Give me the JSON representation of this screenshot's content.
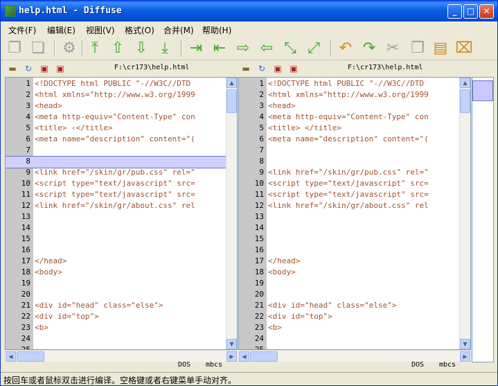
{
  "window": {
    "title": "help.html - Diffuse"
  },
  "menu": [
    "文件(F)",
    "编辑(E)",
    "视图(V)",
    "格式(O)",
    "合并(M)",
    "帮助(H)"
  ],
  "toolbar": {
    "icons": [
      "copy-icon",
      "paste-icon",
      "gear-icon",
      "first-difference-icon",
      "previous-difference-icon",
      "next-difference-icon",
      "last-difference-icon",
      "merge-right-icon",
      "merge-left-icon",
      "copy-right-icon",
      "copy-left-icon",
      "merge-both-right-icon",
      "merge-both-left-icon",
      "undo-icon",
      "redo-icon",
      "cut-icon",
      "copy2-icon",
      "paste2-icon",
      "clear-edits-icon"
    ]
  },
  "left_pane": {
    "path": "F:\\cr173\\help.html",
    "encoding": "DOS",
    "codec": "mbcs",
    "lines": [
      {
        "n": "1",
        "t": "<!DOCTYPE html PUBLIC \"-//W3C//DTD"
      },
      {
        "n": "2",
        "t": "<html xmlns=\"http://www.w3.org/1999"
      },
      {
        "n": "3",
        "t": "<head>"
      },
      {
        "n": "4",
        "t": "<meta http-equiv=\"Content-Type\" con"
      },
      {
        "n": "5",
        "t": "<title>                   ‹</title>"
      },
      {
        "n": "6",
        "t": "<meta name=\"description\" content=\"("
      },
      {
        "n": "7",
        "t": ""
      },
      {
        "n": "8",
        "t": ""
      },
      {
        "n": "9",
        "t": "<link href=\"/skin/gr/pub.css\" rel=\""
      },
      {
        "n": "10",
        "t": "<script type=\"text/javascript\" src="
      },
      {
        "n": "11",
        "t": "<script type=\"text/javascript\" src="
      },
      {
        "n": "12",
        "t": "<link href=\"/skin/gr/about.css\" rel"
      },
      {
        "n": "13",
        "t": ""
      },
      {
        "n": "14",
        "t": ""
      },
      {
        "n": "15",
        "t": ""
      },
      {
        "n": "16",
        "t": ""
      },
      {
        "n": "17",
        "t": "</head>"
      },
      {
        "n": "18",
        "t": "<body>"
      },
      {
        "n": "19",
        "t": ""
      },
      {
        "n": "20",
        "t": ""
      },
      {
        "n": "21",
        "t": " <div id=\"head\" class=\"else\">"
      },
      {
        "n": "22",
        "t": "  <div id=\"top\">"
      },
      {
        "n": "23",
        "t": "    <b>"
      },
      {
        "n": "24",
        "t": ""
      },
      {
        "n": "25",
        "t": ""
      }
    ]
  },
  "right_pane": {
    "path": "F:\\cr173\\help.html",
    "encoding": "DOS",
    "codec": "mbcs",
    "lines": [
      {
        "n": "1",
        "t": "<!DOCTYPE html PUBLIC \"-//W3C//DTD"
      },
      {
        "n": "2",
        "t": "<html xmlns=\"http://www.w3.org/1999"
      },
      {
        "n": "3",
        "t": "<head>"
      },
      {
        "n": "4",
        "t": "<meta http-equiv=\"Content-Type\" con"
      },
      {
        "n": "5",
        "t": "<title>                    </title>"
      },
      {
        "n": "6",
        "t": "<meta name=\"description\" content=\"("
      },
      {
        "n": "7",
        "t": ""
      },
      {
        "n": "8",
        "t": ""
      },
      {
        "n": "9",
        "t": "<link href=\"/skin/gr/pub.css\" rel=\""
      },
      {
        "n": "10",
        "t": "<script type=\"text/javascript\" src="
      },
      {
        "n": "11",
        "t": "<script type=\"text/javascript\" src="
      },
      {
        "n": "12",
        "t": "<link href=\"/skin/gr/about.css\" rel"
      },
      {
        "n": "13",
        "t": ""
      },
      {
        "n": "14",
        "t": ""
      },
      {
        "n": "15",
        "t": ""
      },
      {
        "n": "16",
        "t": ""
      },
      {
        "n": "17",
        "t": "</head>"
      },
      {
        "n": "18",
        "t": "<body>"
      },
      {
        "n": "19",
        "t": ""
      },
      {
        "n": "20",
        "t": ""
      },
      {
        "n": "21",
        "t": " <div id=\"head\" class=\"else\">"
      },
      {
        "n": "22",
        "t": "  <div id=\"top\">"
      },
      {
        "n": "23",
        "t": "    <b>"
      },
      {
        "n": "24",
        "t": ""
      },
      {
        "n": "25",
        "t": ""
      }
    ]
  },
  "status": {
    "message": "按回车或者鼠标双击进行编译。空格键或者右键菜单手动对齐。"
  }
}
